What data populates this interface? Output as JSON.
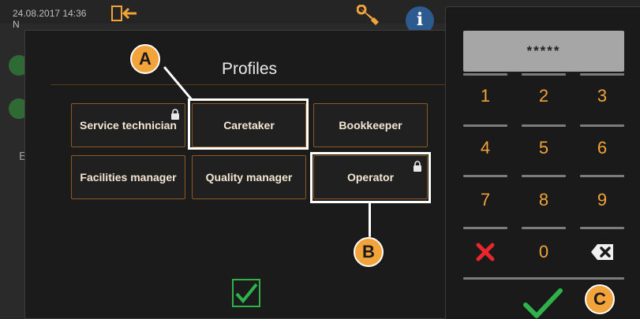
{
  "status_bar": {
    "datetime": "24.08.2017 14:36",
    "partial_text": "N"
  },
  "background": {
    "partial_letter": "E"
  },
  "dialog": {
    "title": "Profiles",
    "profiles": [
      {
        "label": "Service technician",
        "locked": true
      },
      {
        "label": "Caretaker",
        "locked": false
      },
      {
        "label": "Bookkeeper",
        "locked": false
      },
      {
        "label": "Facilities manager",
        "locked": false
      },
      {
        "label": "Quality manager",
        "locked": false
      },
      {
        "label": "Operator",
        "locked": true
      }
    ]
  },
  "keypad": {
    "display": "*****",
    "keys": [
      "1",
      "2",
      "3",
      "4",
      "5",
      "6",
      "7",
      "8",
      "9",
      "0"
    ]
  },
  "callouts": {
    "a": "A",
    "b": "B",
    "c": "C"
  },
  "colors": {
    "accent_orange": "#f2a33a",
    "button_border": "#8b5a22",
    "confirm_green": "#2fb24b",
    "cancel_red": "#e8262b"
  }
}
